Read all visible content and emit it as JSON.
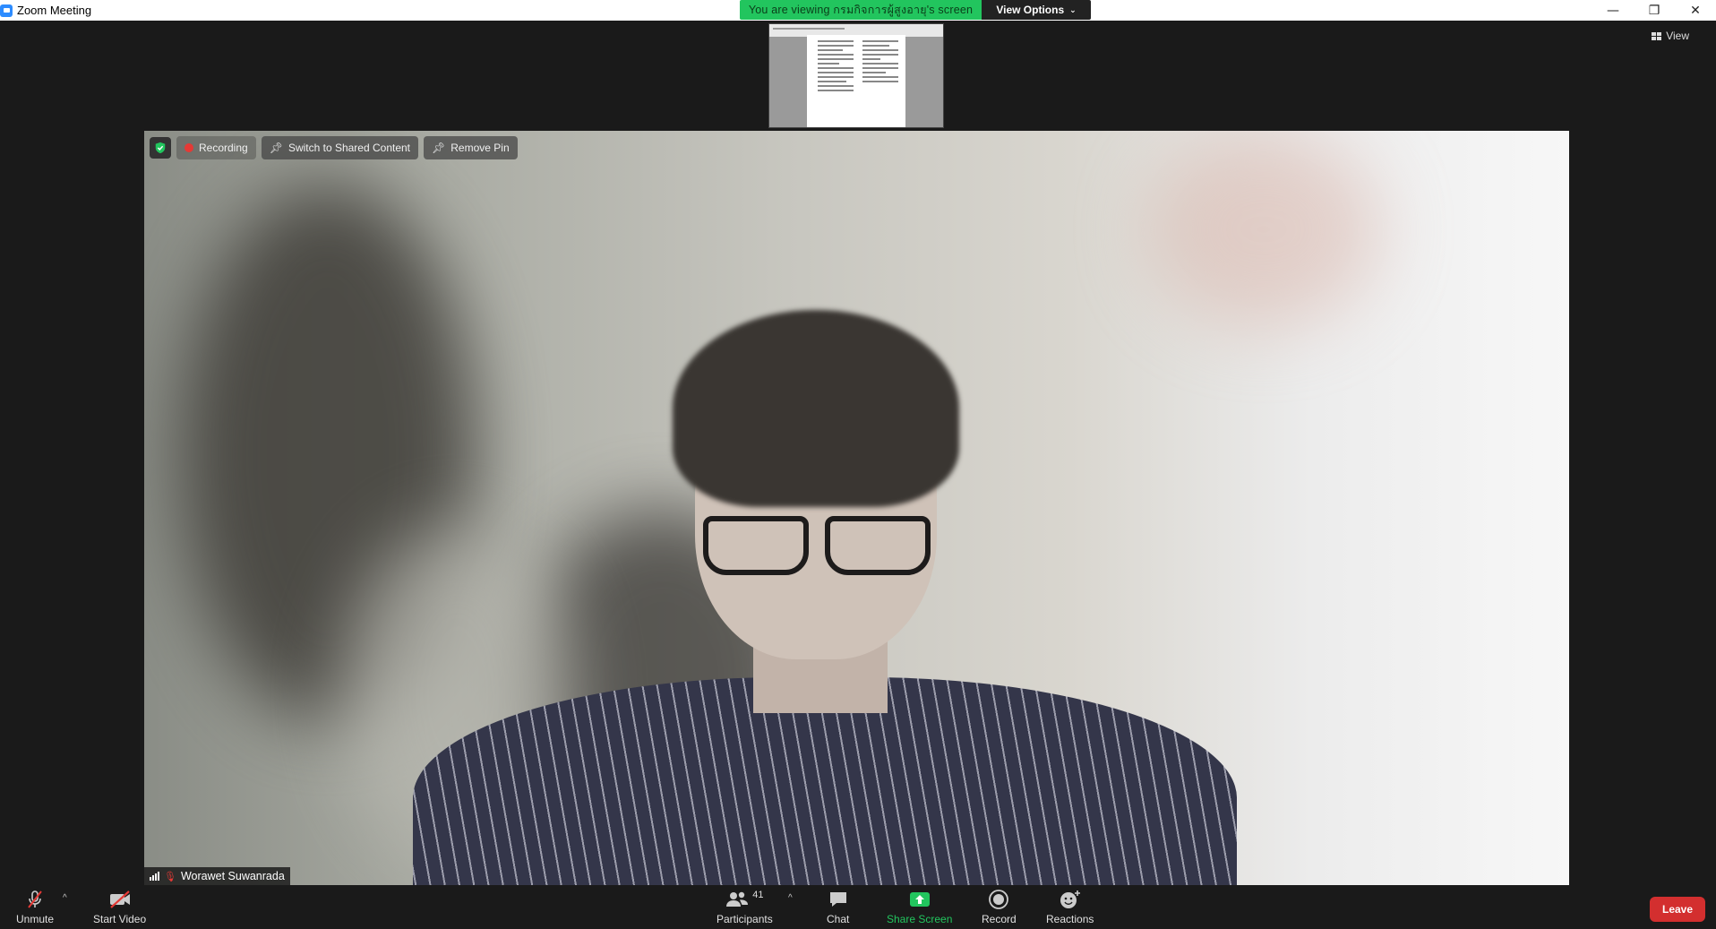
{
  "window": {
    "title": "Zoom Meeting",
    "controls": {
      "minimize": "—",
      "restore": "❐",
      "close": "✕"
    }
  },
  "banner": {
    "viewing_text": "You are viewing กรมกิจการผู้สูงอายุ's screen",
    "view_options": "View Options"
  },
  "view_button": {
    "label": "View"
  },
  "video_overlay": {
    "recording": "Recording",
    "switch_shared": "Switch to Shared Content",
    "remove_pin": "Remove Pin"
  },
  "participant": {
    "name": "Worawet Suwanrada"
  },
  "toolbar": {
    "unmute": "Unmute",
    "start_video": "Start Video",
    "participants": "Participants",
    "participants_count": "41",
    "chat": "Chat",
    "share_screen": "Share Screen",
    "record": "Record",
    "reactions": "Reactions",
    "leave": "Leave"
  },
  "colors": {
    "banner_green": "#22c55e",
    "share_green": "#22c55e",
    "leave_red": "#d32f2f",
    "recording_red": "#e53935"
  }
}
